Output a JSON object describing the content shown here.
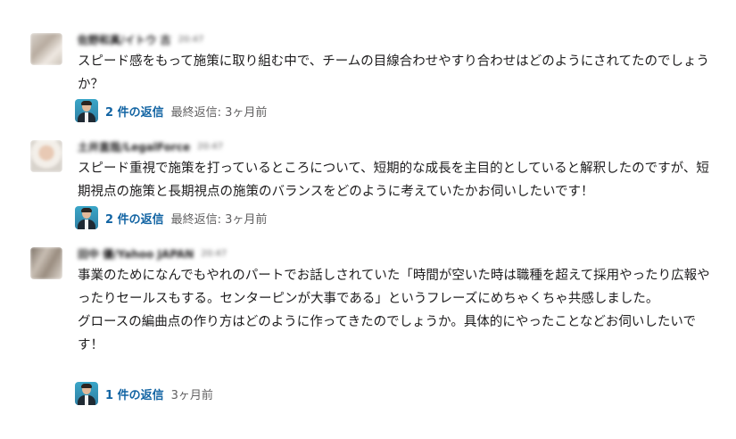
{
  "messages": [
    {
      "sender": "佐野和真/イトウ 古",
      "time": "20:47",
      "body_lines": [
        "スピード感をもって施策に取り組む中で、チームの目線合わせやすり合わせはどのようにされてたのでしょうか？"
      ],
      "thread": {
        "reply_count": "2 件の返信",
        "last_reply": "最終返信: 3ヶ月前",
        "avatar_icon": "replier-avatar-icon"
      }
    },
    {
      "sender": "土井直哉/LegalForce",
      "time": "20:47",
      "body_lines": [
        "スピード重視で施策を打っているところについて、短期的な成長を主目的としていると解釈したのですが、短期視点の施策と長期視点の施策のバランスをどのように考えていたかお伺いしたいです！"
      ],
      "thread": {
        "reply_count": "2 件の返信",
        "last_reply": "最終返信: 3ヶ月前",
        "avatar_icon": "replier-avatar-icon"
      }
    },
    {
      "sender": "田中 優/Yahoo JAPAN",
      "time": "20:47",
      "body_lines": [
        "事業のためになんでもやれのパートでお話しされていた「時間が空いた時は職種を超えて採用やったり広報やったりセールスもする。センターピンが大事である」というフレーズにめちゃくちゃ共感しました。",
        "グロースの編曲点の作り方はどのように作ってきたのでしょうか。具体的にやったことなどお伺いしたいです！"
      ],
      "thread": {
        "reply_count": "1 件の返信",
        "last_reply": "3ヶ月前",
        "avatar_icon": "replier-avatar-icon"
      }
    }
  ]
}
